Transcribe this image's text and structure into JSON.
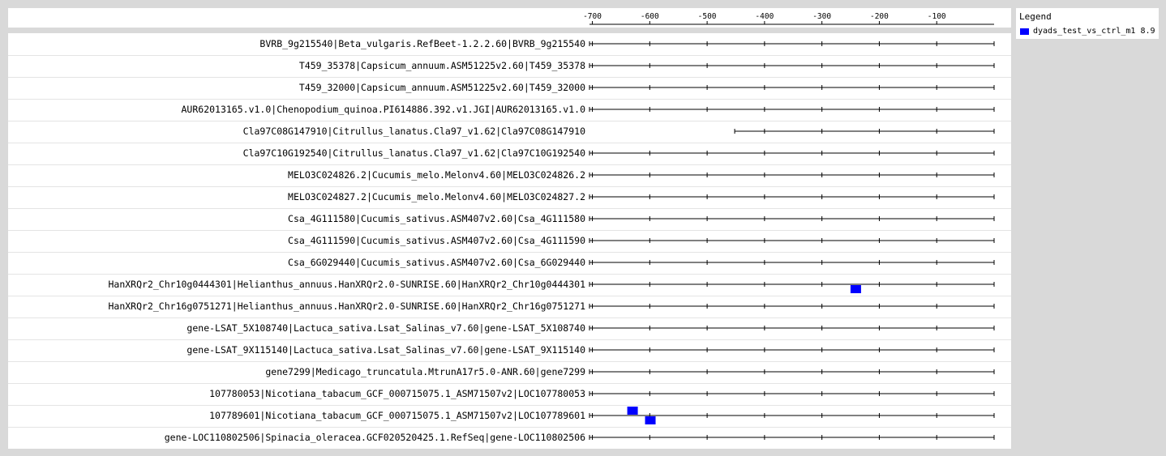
{
  "axis": {
    "ticks": [
      -700,
      -600,
      -500,
      -400,
      -300,
      -200,
      -100
    ],
    "min": -705,
    "max": 0
  },
  "legend": {
    "title": "Legend",
    "items": [
      {
        "label": "dyads_test_vs_ctrl_m1 8.9",
        "color": "#0000ff"
      }
    ]
  },
  "sequences": [
    {
      "label": "BVRB_9g215540|Beta_vulgaris.RefBeet-1.2.2.60|BVRB_9g215540",
      "start": -705,
      "motifs": []
    },
    {
      "label": "T459_35378|Capsicum_annuum.ASM51225v2.60|T459_35378",
      "start": -705,
      "motifs": []
    },
    {
      "label": "T459_32000|Capsicum_annuum.ASM51225v2.60|T459_32000",
      "start": -705,
      "motifs": []
    },
    {
      "label": "AUR62013165.v1.0|Chenopodium_quinoa.PI614886.392.v1.JGI|AUR62013165.v1.0",
      "start": -705,
      "motifs": []
    },
    {
      "label": "Cla97C08G147910|Citrullus_lanatus.Cla97_v1.62|Cla97C08G147910",
      "start": -452,
      "motifs": []
    },
    {
      "label": "Cla97C10G192540|Citrullus_lanatus.Cla97_v1.62|Cla97C10G192540",
      "start": -705,
      "motifs": []
    },
    {
      "label": "MELO3C024826.2|Cucumis_melo.Melonv4.60|MELO3C024826.2",
      "start": -705,
      "motifs": []
    },
    {
      "label": "MELO3C024827.2|Cucumis_melo.Melonv4.60|MELO3C024827.2",
      "start": -705,
      "motifs": []
    },
    {
      "label": "Csa_4G111580|Cucumis_sativus.ASM407v2.60|Csa_4G111580",
      "start": -705,
      "motifs": []
    },
    {
      "label": "Csa_4G111590|Cucumis_sativus.ASM407v2.60|Csa_4G111590",
      "start": -705,
      "motifs": []
    },
    {
      "label": "Csa_6G029440|Cucumis_sativus.ASM407v2.60|Csa_6G029440",
      "start": -705,
      "motifs": []
    },
    {
      "label": "HanXRQr2_Chr10g0444301|Helianthus_annuus.HanXRQr2.0-SUNRISE.60|HanXRQr2_Chr10g0444301",
      "start": -705,
      "motifs": [
        {
          "pos": -241,
          "strand": "-"
        }
      ]
    },
    {
      "label": "HanXRQr2_Chr16g0751271|Helianthus_annuus.HanXRQr2.0-SUNRISE.60|HanXRQr2_Chr16g0751271",
      "start": -705,
      "motifs": []
    },
    {
      "label": "gene-LSAT_5X108740|Lactuca_sativa.Lsat_Salinas_v7.60|gene-LSAT_5X108740",
      "start": -705,
      "motifs": []
    },
    {
      "label": "gene-LSAT_9X115140|Lactuca_sativa.Lsat_Salinas_v7.60|gene-LSAT_9X115140",
      "start": -705,
      "motifs": []
    },
    {
      "label": "gene7299|Medicago_truncatula.MtrunA17r5.0-ANR.60|gene7299",
      "start": -705,
      "motifs": []
    },
    {
      "label": "107780053|Nicotiana_tabacum_GCF_000715075.1_ASM71507v2|LOC107780053",
      "start": -705,
      "motifs": []
    },
    {
      "label": "107789601|Nicotiana_tabacum_GCF_000715075.1_ASM71507v2|LOC107789601",
      "start": -705,
      "motifs": [
        {
          "pos": -630,
          "strand": "+"
        },
        {
          "pos": -599,
          "strand": "-"
        }
      ]
    },
    {
      "label": "gene-LOC110802506|Spinacia_oleracea.GCF020520425.1.RefSeq|gene-LOC110802506",
      "start": -705,
      "motifs": []
    }
  ]
}
